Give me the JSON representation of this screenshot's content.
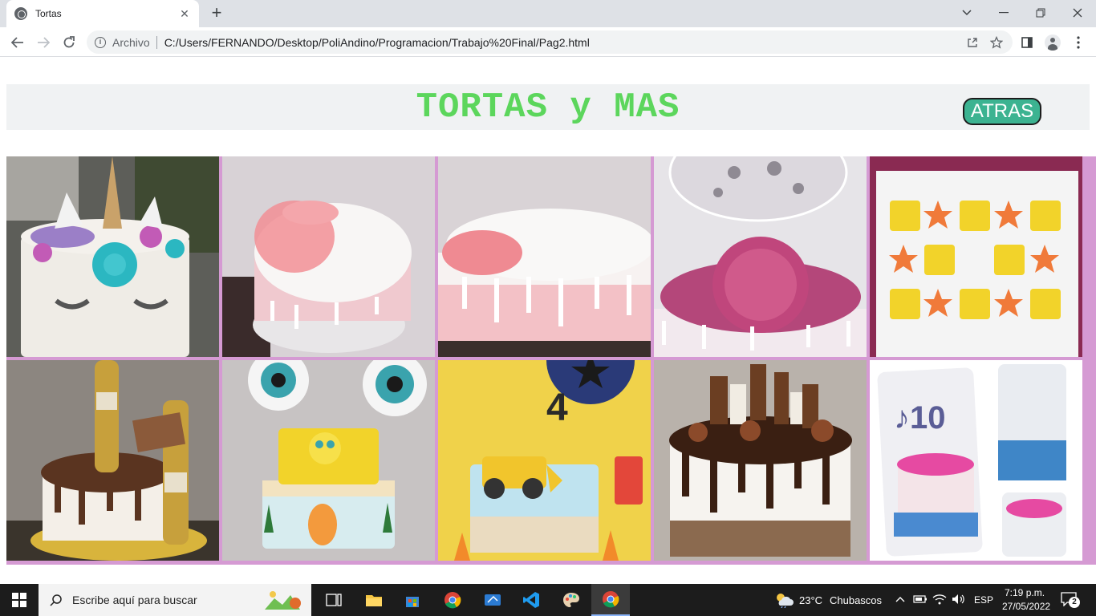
{
  "browser": {
    "tab_title": "Tortas",
    "tab_close": "✕",
    "new_tab": "+",
    "address_scheme": "Archivo",
    "address_url": "C:/Users/FERNANDO/Desktop/PoliAndino/Programacion/Trabajo%20Final/Pag2.html"
  },
  "header": {
    "title": "TORTAS y MAS",
    "back_button": "ATRAS"
  },
  "gallery": {
    "items": [
      {
        "label": "unicorn-cake"
      },
      {
        "label": "white-pink-rosettes-cake"
      },
      {
        "label": "pink-drip-cake"
      },
      {
        "label": "balloon-cake"
      },
      {
        "label": "spongebob-cookies"
      },
      {
        "label": "beer-chocolate-cake"
      },
      {
        "label": "spongebob-cake"
      },
      {
        "label": "construction-cake"
      },
      {
        "label": "chocolate-drip-cake"
      },
      {
        "label": "tiktok-cake"
      }
    ]
  },
  "taskbar": {
    "search_placeholder": "Escribe aquí para buscar",
    "weather_temp": "23°C",
    "weather_desc": "Chubascos",
    "language": "ESP",
    "time": "7:19 p.m.",
    "date": "27/05/2022",
    "notification_count": "2"
  }
}
